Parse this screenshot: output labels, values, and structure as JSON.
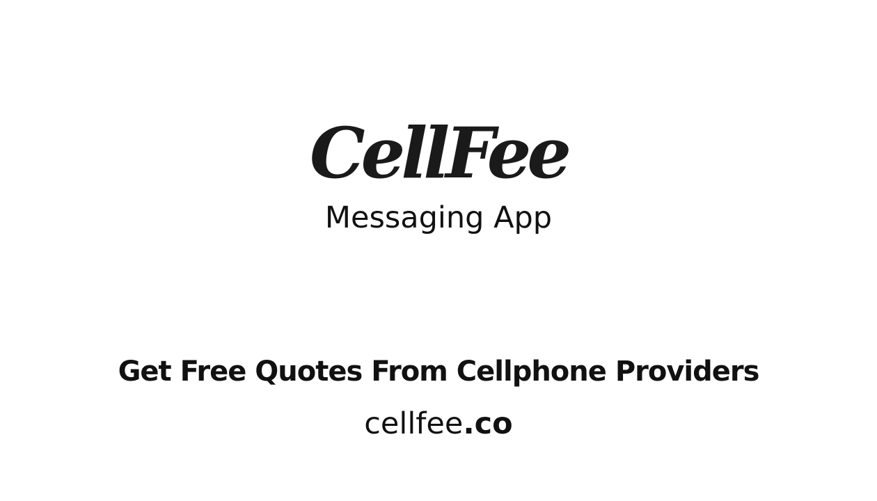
{
  "brand": {
    "logo_text": "CellFee",
    "subtitle": "Messaging App"
  },
  "tagline": {
    "headline": "Get Free Quotes From Cellphone Providers"
  },
  "website": {
    "name": "cellfee",
    "tld": ".co"
  }
}
